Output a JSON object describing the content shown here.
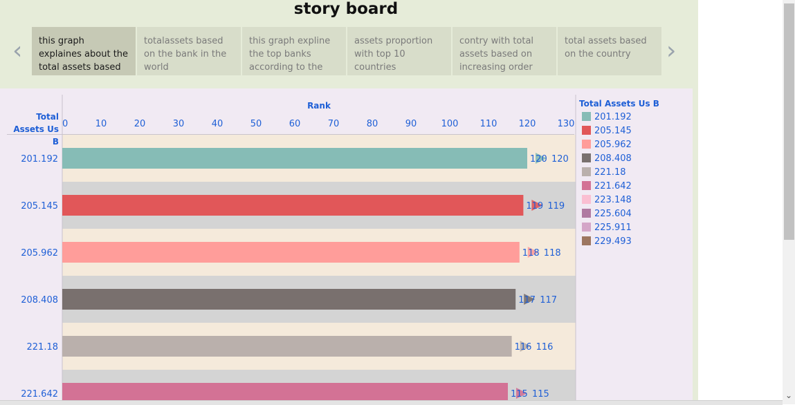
{
  "story": {
    "title": "story board",
    "prev_icon": "chevron-left-icon",
    "next_icon": "chevron-right-icon",
    "prev_glyph": "‹",
    "next_glyph": "›",
    "tabs": [
      {
        "label": "this graph explaines about the total assets based",
        "active": true
      },
      {
        "label": "totalassets  based on the bank in the world",
        "active": false
      },
      {
        "label": "this graph expline the top banks according to the",
        "active": false
      },
      {
        "label": "assets proportion with top 10 countries",
        "active": false
      },
      {
        "label": "contry with total assets based on increasing order",
        "active": false
      },
      {
        "label": "total assets based on the country",
        "active": false
      }
    ]
  },
  "chart_data": {
    "type": "bar",
    "orientation": "horizontal",
    "row_header": "Total Assets Us B",
    "xlabel": "Rank",
    "xlim": [
      0,
      130
    ],
    "x_ticks": [
      0,
      10,
      20,
      30,
      40,
      50,
      60,
      70,
      80,
      90,
      100,
      110,
      120,
      130
    ],
    "categories": [
      "201.192",
      "205.145",
      "205.962",
      "208.408",
      "221.18",
      "221.642"
    ],
    "values": [
      120,
      119,
      118,
      117,
      116,
      115
    ],
    "colors": [
      "#86bcb6",
      "#e15759",
      "#ff9d9a",
      "#79706e",
      "#bab0ac",
      "#d37295"
    ],
    "legend": {
      "title": "Total Assets Us B",
      "placement": "right",
      "items": [
        {
          "label": "201.192",
          "color": "#86bcb6"
        },
        {
          "label": "205.145",
          "color": "#e15759"
        },
        {
          "label": "205.962",
          "color": "#ff9d9a"
        },
        {
          "label": "208.408",
          "color": "#79706e"
        },
        {
          "label": "221.18",
          "color": "#bab0ac"
        },
        {
          "label": "221.642",
          "color": "#d37295"
        },
        {
          "label": "223.148",
          "color": "#fabfd2"
        },
        {
          "label": "225.604",
          "color": "#b07aa1"
        },
        {
          "label": "225.911",
          "color": "#d4a6c8"
        },
        {
          "label": "229.493",
          "color": "#9d7660"
        }
      ]
    },
    "row_band_colors": [
      "#f5eadb",
      "#d4d4d4"
    ],
    "label_color": "#1e5fd6"
  }
}
